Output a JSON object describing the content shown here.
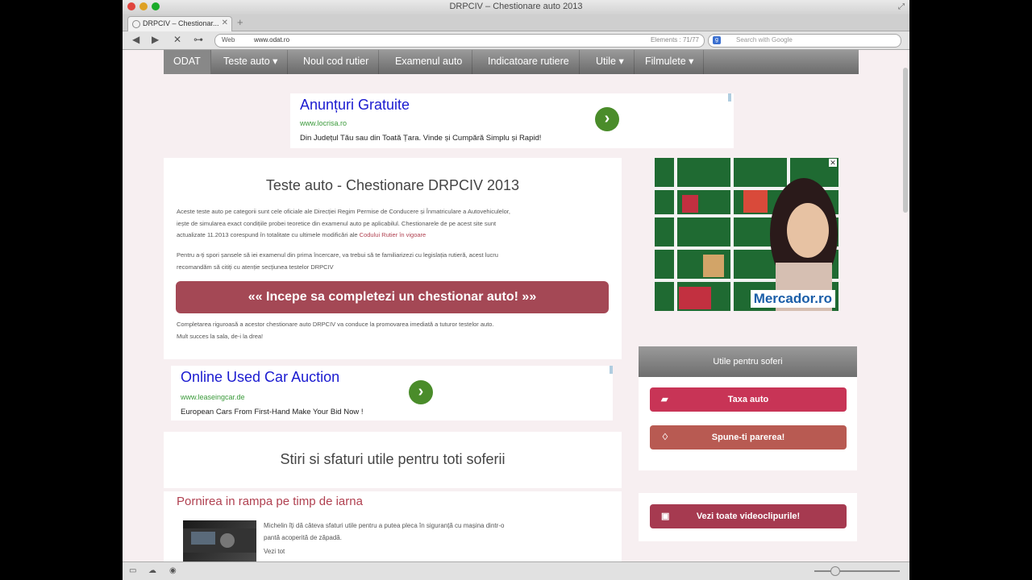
{
  "window": {
    "title": "DRPCIV – Chestionare auto 2013"
  },
  "tab": {
    "title": "DRPCIV – Chestionar..."
  },
  "toolbar": {
    "url_prefix": "Web",
    "url": "www.odat.ro",
    "elements": "Elements : 71/77",
    "search_placeholder": "Search with Google"
  },
  "nav": {
    "items": [
      "ODAT",
      "Teste auto ▾",
      "Noul cod rutier",
      "Examenul auto",
      "Indicatoare rutiere",
      "Utile ▾",
      "Filmulete ▾"
    ]
  },
  "ad_top": {
    "title": "Anunțuri Gratuite",
    "url": "www.locrisa.ro",
    "desc": "Din Județul Tău sau din Toată Țara. Vinde și Cumpără Simplu și Rapid!"
  },
  "main_card": {
    "title": "Teste auto - Chestionare DRPCIV 2013",
    "p1_a": "Aceste teste auto pe categorii sunt cele oficiale ale Direcției Regim Permise de Conducere și Înmatriculare a Autovehiculelor,",
    "p1_b": "iește de simularea exact condițiile probei teoretice din examenul auto pe aplicabilul. Chestionarele de pe acest site sunt",
    "p1_c_pre": "actualizate 11.2013 corespund în totalitate cu ultimele modificări ale ",
    "p1_c_link": "Codului Rutier în vigoare",
    "p2_a": "Pentru a-ți spori șansele să iei examenul din prima încercare, va trebui să te familiarizezi cu legislația rutieră, acest lucru",
    "p2_b": "recomandăm să citiți cu atenție secțiunea testelor DRPCIV",
    "cta": "«« Incepe sa completezi un chestionar auto! »»",
    "p3_a": "Completarea riguroasă a acestor chestionare auto DRPCIV va conduce la promovarea imediată a tuturor testelor auto.",
    "p3_b": "Mult succes la sala, de-i la drea!"
  },
  "ad_mid": {
    "title": "Online Used Car Auction",
    "url": "www.leaseingcar.de",
    "desc": "European Cars From First-Hand Make Your Bid Now !"
  },
  "news": {
    "section_title": "Stiri si sfaturi utile pentru toti soferii",
    "item_title": "Pornirea in rampa pe timp de iarna",
    "item_text_a": "Michelin îți dă câteva sfaturi utile pentru a putea pleca în siguranță cu mașina dintr-o",
    "item_text_b": "pantă acoperită de zăpadă.",
    "item_more": "Vezi tot"
  },
  "sidebar": {
    "ad_brand": "Mercador.ro",
    "heading": "Utile pentru soferi",
    "btn_tax": "Taxa auto",
    "btn_opinion": "Spune-ti parerea!",
    "btn_videos": "Vezi toate videoclipurile!"
  },
  "colors": {
    "nav_bg": "#7d7d7d",
    "cta": "#a44855",
    "btn_tax": "#c83456",
    "btn_opinion": "#b85a52",
    "btn_videos": "#a63a50"
  }
}
